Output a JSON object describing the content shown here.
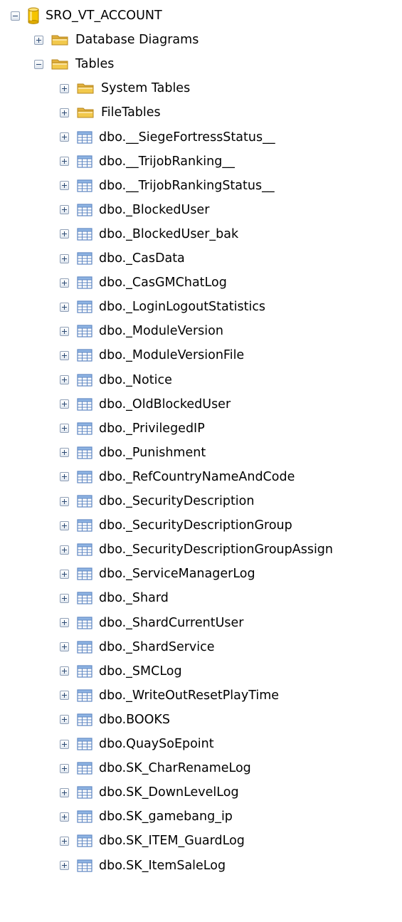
{
  "tree": {
    "database": {
      "label": "SRO_VT_ACCOUNT",
      "expanded": true,
      "icon": "database-icon",
      "icon_color": "#f5c400"
    },
    "folders": [
      {
        "label": "Database Diagrams",
        "expanded": false,
        "icon": "folder-icon"
      },
      {
        "label": "Tables",
        "expanded": true,
        "icon": "folder-icon"
      }
    ],
    "table_folders": [
      {
        "label": "System Tables",
        "expanded": false,
        "icon": "folder-icon"
      },
      {
        "label": "FileTables",
        "expanded": false,
        "icon": "folder-icon"
      }
    ],
    "tables": [
      "dbo.__SiegeFortressStatus__",
      "dbo.__TrijobRanking__",
      "dbo.__TrijobRankingStatus__",
      "dbo._BlockedUser",
      "dbo._BlockedUser_bak",
      "dbo._CasData",
      "dbo._CasGMChatLog",
      "dbo._LoginLogoutStatistics",
      "dbo._ModuleVersion",
      "dbo._ModuleVersionFile",
      "dbo._Notice",
      "dbo._OldBlockedUser",
      "dbo._PrivilegedIP",
      "dbo._Punishment",
      "dbo._RefCountryNameAndCode",
      "dbo._SecurityDescription",
      "dbo._SecurityDescriptionGroup",
      "dbo._SecurityDescriptionGroupAssign",
      "dbo._ServiceManagerLog",
      "dbo._Shard",
      "dbo._ShardCurrentUser",
      "dbo._ShardService",
      "dbo._SMCLog",
      "dbo._WriteOutResetPlayTime",
      "dbo.BOOKS",
      "dbo.QuaySoEpoint",
      "dbo.SK_CharRenameLog",
      "dbo.SK_DownLevelLog",
      "dbo.SK_gamebang_ip",
      "dbo.SK_ITEM_GuardLog",
      "dbo.SK_ItemSaleLog"
    ],
    "table_icon": "table-icon",
    "colors": {
      "folder": "#f2c94c",
      "table_header": "#8fb4e3",
      "table_grid": "#5d86c2",
      "expander_border": "#8f9fb6"
    }
  }
}
